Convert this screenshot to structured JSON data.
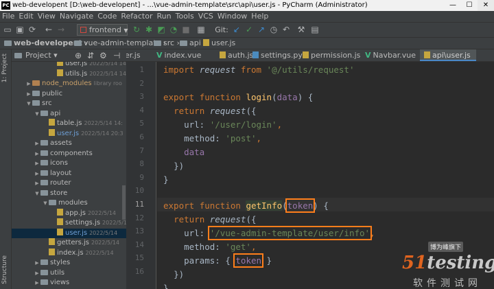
{
  "window": {
    "title": "web-developent [D:\\web-developent] - ...\\vue-admin-template\\src\\api\\user.js - PyCharm (Administrator)",
    "app_badge": "PC",
    "minimize": "—",
    "maximize": "☐",
    "close": "✕"
  },
  "menu": [
    "File",
    "Edit",
    "View",
    "Navigate",
    "Code",
    "Refactor",
    "Run",
    "Tools",
    "VCS",
    "Window",
    "Help"
  ],
  "toolbar": {
    "run_config": "frontend",
    "git_label": "Git:"
  },
  "breadcrumb": [
    "web-developent",
    "vue-admin-template",
    "src",
    "api",
    "user.js"
  ],
  "project_panel": {
    "title": "Project",
    "side_tab": "1: Project",
    "side_tab2": "Structure",
    "tree": [
      {
        "name": "user.js",
        "date": "2022/5/14 14:50, 5",
        "type": "js",
        "depth": 4
      },
      {
        "name": "utils.js",
        "date": "2022/5/14 14:50, 5",
        "type": "js",
        "depth": 4
      },
      {
        "name": "node_modules",
        "date": "library roo",
        "type": "folder",
        "depth": 1,
        "expanded": false,
        "highlight": "lib"
      },
      {
        "name": "public",
        "date": "",
        "type": "folder",
        "depth": 1,
        "expanded": false
      },
      {
        "name": "src",
        "date": "",
        "type": "folder",
        "depth": 1,
        "expanded": true
      },
      {
        "name": "api",
        "date": "",
        "type": "folder",
        "depth": 2,
        "expanded": true
      },
      {
        "name": "table.js",
        "date": "2022/5/14 14:",
        "type": "js",
        "depth": 3
      },
      {
        "name": "user.js",
        "date": "2022/5/14 20:3",
        "type": "js",
        "depth": 3,
        "active": true
      },
      {
        "name": "assets",
        "date": "",
        "type": "folder",
        "depth": 2,
        "expanded": false
      },
      {
        "name": "components",
        "date": "",
        "type": "folder",
        "depth": 2,
        "expanded": false
      },
      {
        "name": "icons",
        "date": "",
        "type": "folder",
        "depth": 2,
        "expanded": false
      },
      {
        "name": "layout",
        "date": "",
        "type": "folder",
        "depth": 2,
        "expanded": false
      },
      {
        "name": "router",
        "date": "",
        "type": "folder",
        "depth": 2,
        "expanded": false
      },
      {
        "name": "store",
        "date": "",
        "type": "folder",
        "depth": 2,
        "expanded": true
      },
      {
        "name": "modules",
        "date": "",
        "type": "folder",
        "depth": 3,
        "expanded": true
      },
      {
        "name": "app.js",
        "date": "2022/5/14",
        "type": "js",
        "depth": 4
      },
      {
        "name": "settings.js",
        "date": "2022/5/1",
        "type": "js",
        "depth": 4
      },
      {
        "name": "user.js",
        "date": "2022/5/14",
        "type": "js",
        "depth": 4,
        "selected": true
      },
      {
        "name": "getters.js",
        "date": "2022/5/14",
        "type": "js",
        "depth": 3
      },
      {
        "name": "index.js",
        "date": "2022/5/14",
        "type": "js",
        "depth": 3
      },
      {
        "name": "styles",
        "date": "",
        "type": "folder",
        "depth": 2,
        "expanded": false
      },
      {
        "name": "utils",
        "date": "",
        "type": "folder",
        "depth": 2,
        "expanded": false
      },
      {
        "name": "views",
        "date": "",
        "type": "folder",
        "depth": 2,
        "expanded": false
      }
    ]
  },
  "tabs": [
    {
      "label": "er.js",
      "icon": "js"
    },
    {
      "label": "index.vue",
      "icon": "vue"
    },
    {
      "label": "auth.js",
      "icon": "js"
    },
    {
      "label": "settings.py",
      "icon": "py"
    },
    {
      "label": "permission.js",
      "icon": "js"
    },
    {
      "label": "Navbar.vue",
      "icon": "vue"
    },
    {
      "label": "api\\user.js",
      "icon": "js",
      "active": true
    }
  ],
  "editor": {
    "current_line": 11,
    "line_numbers": [
      "1",
      "2",
      "3",
      "4",
      "5",
      "6",
      "7",
      "8",
      "9",
      "10",
      "11",
      "12",
      "13",
      "14",
      "15",
      "16"
    ],
    "code": {
      "l1_kw": "import",
      "l1_name": "request",
      "l1_from": "from",
      "l1_str": "'@/utils/request'",
      "l3_kw1": "export",
      "l3_kw2": "function",
      "l3_fn": "login",
      "l3_open": "(",
      "l3_par": "data",
      "l3_close": ") {",
      "l4_kw": "return",
      "l4_call": "request",
      "l4_tail": "({",
      "l5_key": "url: ",
      "l5_str": "'/user/login'",
      "l5_tail": ",",
      "l6_key": "method: ",
      "l6_str": "'post'",
      "l6_tail": ",",
      "l7_par": "data",
      "l8": "})",
      "l9": "}",
      "l11_kw1": "export",
      "l11_kw2": "function",
      "l11_fn": "getInfo",
      "l11_open": "(",
      "l11_par": "token",
      "l11_close": ") {",
      "l12_kw": "return",
      "l12_call": "request",
      "l12_tail": "({",
      "l13_key": "url: ",
      "l13_str": "'/vue-admin-template/user/info'",
      "l13_tail": ",",
      "l14_key": "method: ",
      "l14_str": "'get'",
      "l14_tail": ",",
      "l15_key": "params: ",
      "l15_open": "{ ",
      "l15_par": "token",
      "l15_close": " }",
      "l16": "})",
      "l17": "}"
    }
  },
  "watermark": {
    "tag": "博为峰旗下",
    "brand_a": "51",
    "brand_b": "testing",
    "cn": "软件测试网"
  },
  "colors": {
    "keyword": "#cc7832",
    "string": "#6a8759",
    "function": "#ffc66d",
    "param": "#9876aa",
    "annotation_box": "#ff7e1b"
  }
}
